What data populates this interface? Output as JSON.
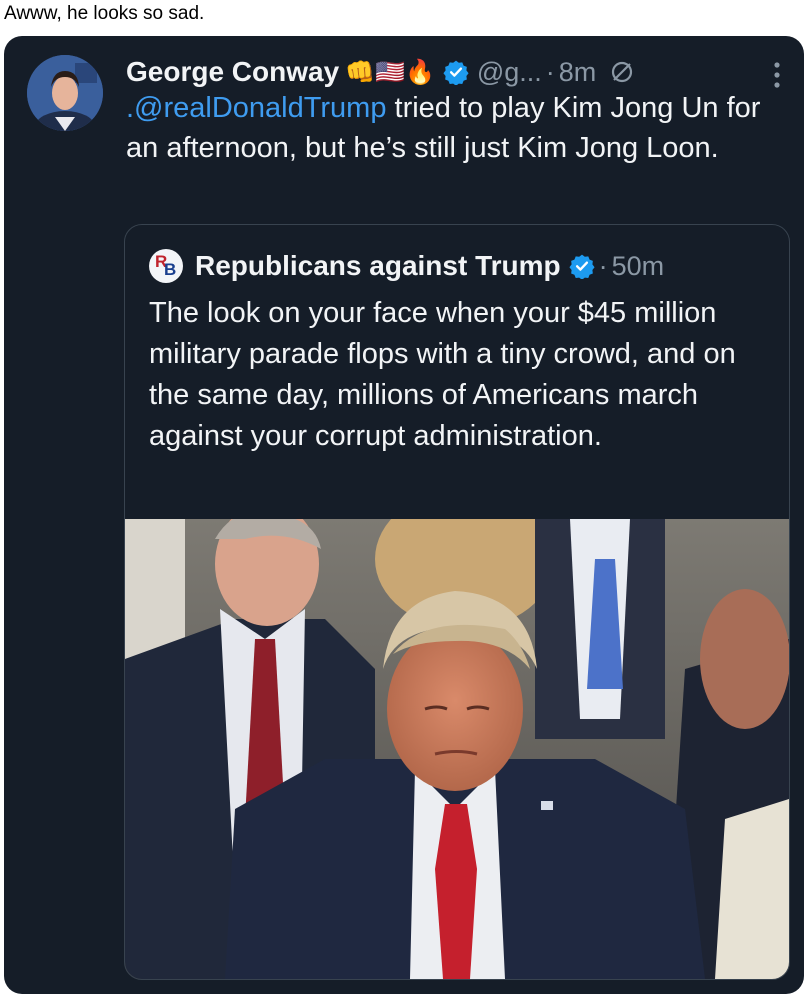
{
  "caption": "Awww, he looks so sad.",
  "tweet": {
    "author": "George Conway",
    "emojis": "👊🇺🇸🔥",
    "handle": "@g...",
    "time": "8m",
    "text_mention": ".@realDonaldTrump",
    "text_rest": " tried to play Kim Jong Un for an afternoon, but he’s still just Kim Jong Loon."
  },
  "quote": {
    "author": "Republicans against Trump",
    "logo_letters": {
      "r": "R",
      "b": "B"
    },
    "time": "50m",
    "text": "The look on your face when your $45 million military parade flops with a tiny crowd, and on the same day, millions of Americans march against your corrupt administration."
  },
  "colors": {
    "card_bg": "#151d28",
    "text": "#f2f4f6",
    "muted": "#8b98a5",
    "link": "#3f9cf0",
    "verified": "#1d9bf0"
  },
  "icons": [
    "verified-badge-icon",
    "no-entry-icon",
    "more-icon",
    "news-logo-icon"
  ]
}
